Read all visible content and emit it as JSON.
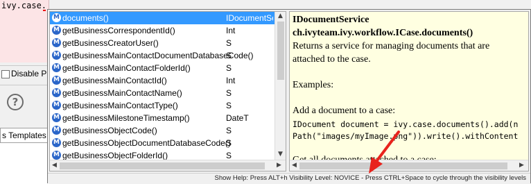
{
  "editor": {
    "code_text": "ivy.case.",
    "disable_label": "Disable P",
    "templates_tab": "s Templates",
    "help_glyph": "?"
  },
  "completion": {
    "items": [
      {
        "icon": "M",
        "name": "documents()",
        "type": "IDocumentSe"
      },
      {
        "icon": "M",
        "name": "getBusinessCorrespondentId()",
        "type": "Int"
      },
      {
        "icon": "M",
        "name": "getBusinessCreatorUser()",
        "type": "S"
      },
      {
        "icon": "M",
        "name": "getBusinessMainContactDocumentDatabaseCode()",
        "type": "S"
      },
      {
        "icon": "M",
        "name": "getBusinessMainContactFolderId()",
        "type": "S"
      },
      {
        "icon": "M",
        "name": "getBusinessMainContactId()",
        "type": "Int"
      },
      {
        "icon": "M",
        "name": "getBusinessMainContactName()",
        "type": "S"
      },
      {
        "icon": "M",
        "name": "getBusinessMainContactType()",
        "type": "S"
      },
      {
        "icon": "M",
        "name": "getBusinessMilestoneTimestamp()",
        "type": "DateT"
      },
      {
        "icon": "M",
        "name": "getBusinessObjectCode()",
        "type": "S"
      },
      {
        "icon": "M",
        "name": "getBusinessObjectDocumentDatabaseCode()",
        "type": "S"
      },
      {
        "icon": "M",
        "name": "getBusinessObjectFolderId()",
        "type": "S"
      }
    ],
    "selected_index": 0
  },
  "doc": {
    "title1": "IDocumentService",
    "title2": "ch.ivyteam.ivy.workflow.ICase.documents()",
    "desc1": "Returns a service for managing documents that are",
    "desc2": "attached to the case.",
    "examples": "Examples:",
    "add_doc": "Add a document to a case:",
    "code1": "IDocument document = ivy.case.documents().add(n",
    "code2": "Path(\"images/myImage.png\")).write().withContent",
    "get_all": "Get all documents attached to a case:"
  },
  "status": {
    "text": "Show Help: Press ALT+h  Visibility Level: NOVICE - Press CTRL+Space to cycle through the visibility levels"
  },
  "colors": {
    "selection": "#3399ff",
    "doc_background": "#ffffe1",
    "annotation_arrow": "#e8231c"
  }
}
